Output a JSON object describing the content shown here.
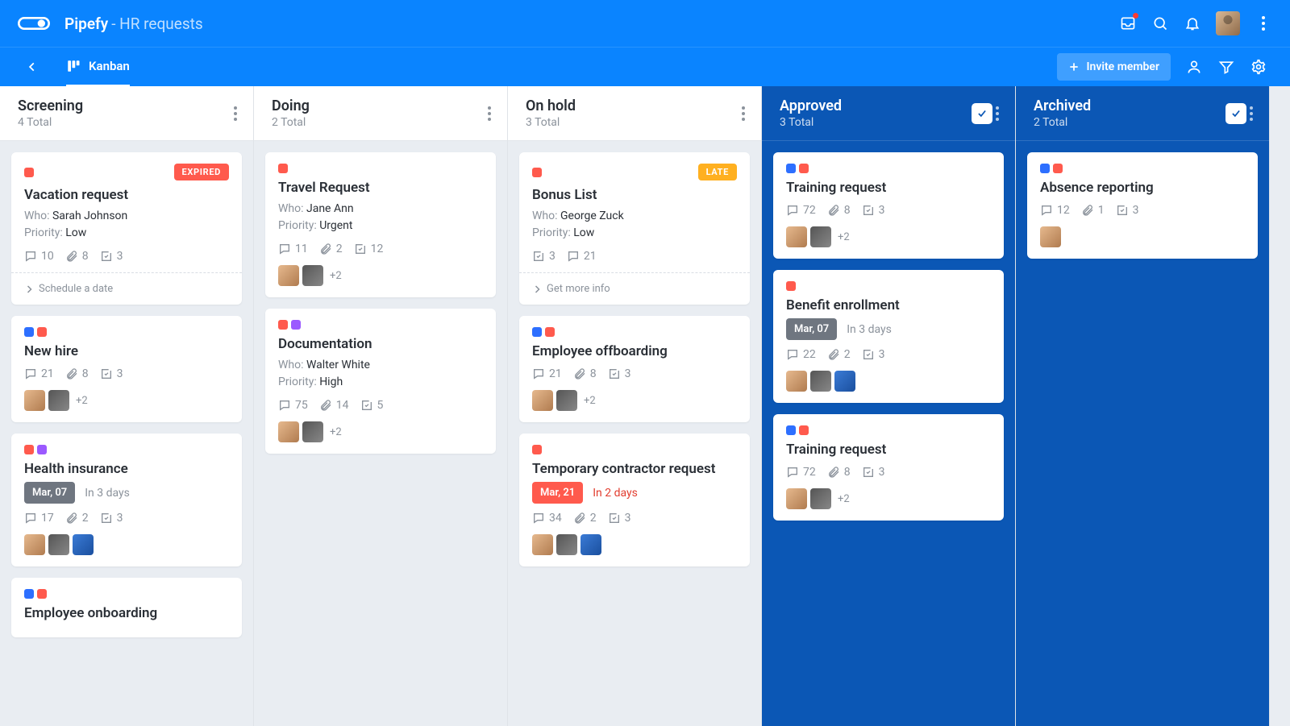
{
  "header": {
    "app": "Pipefy",
    "pipe": "HR requests",
    "invite_label": "Invite member",
    "kanban_label": "Kanban"
  },
  "columns": [
    {
      "title": "Screening",
      "count": "4 Total",
      "final": false,
      "cards": [
        {
          "labels": [
            "red"
          ],
          "badge": {
            "text": "EXPIRED",
            "type": "expired"
          },
          "title": "Vacation request",
          "who": "Sarah Johnson",
          "priority": "Low",
          "stats": {
            "comments": 10,
            "attach": 8,
            "tasks": 3
          },
          "action": "Schedule a date"
        },
        {
          "labels": [
            "blue",
            "red"
          ],
          "title": "New hire",
          "stats": {
            "comments": 21,
            "attach": 8,
            "tasks": 3
          },
          "assignees": {
            "list": [
              "a1",
              "a2"
            ],
            "more": "+2"
          }
        },
        {
          "labels": [
            "red",
            "purple"
          ],
          "title": "Health insurance",
          "due": {
            "chip": "Mar, 07",
            "chip_style": "gray",
            "rel": "In 3 days",
            "rel_style": "gray"
          },
          "stats": {
            "comments": 17,
            "attach": 2,
            "tasks": 3
          },
          "assignees": {
            "list": [
              "a1",
              "a2",
              "a3"
            ]
          }
        },
        {
          "labels": [
            "blue",
            "red"
          ],
          "title": "Employee onboarding"
        }
      ]
    },
    {
      "title": "Doing",
      "count": "2 Total",
      "final": false,
      "cards": [
        {
          "labels": [
            "red"
          ],
          "title": "Travel Request",
          "who": "Jane Ann",
          "priority": "Urgent",
          "stats": {
            "comments": 11,
            "attach": 2,
            "tasks": 12
          },
          "assignees": {
            "list": [
              "a1",
              "a2"
            ],
            "more": "+2"
          }
        },
        {
          "labels": [
            "red",
            "purple"
          ],
          "title": "Documentation",
          "who": "Walter White",
          "priority": "High",
          "stats": {
            "comments": 75,
            "attach": 14,
            "tasks": 5
          },
          "assignees": {
            "list": [
              "a1",
              "a2"
            ],
            "more": "+2"
          }
        }
      ]
    },
    {
      "title": "On hold",
      "count": "3 Total",
      "final": false,
      "cards": [
        {
          "labels": [
            "red"
          ],
          "badge": {
            "text": "LATE",
            "type": "late"
          },
          "title": "Bonus List",
          "who": "George Zuck",
          "priority": "Low",
          "stats": {
            "tasks": 3,
            "comments": 21
          },
          "action": "Get more info"
        },
        {
          "labels": [
            "blue",
            "red"
          ],
          "title": "Employee offboarding",
          "stats": {
            "comments": 21,
            "attach": 8,
            "tasks": 3
          },
          "assignees": {
            "list": [
              "a1",
              "a2"
            ],
            "more": "+2"
          }
        },
        {
          "labels": [
            "red"
          ],
          "title": "Temporary contractor request",
          "due": {
            "chip": "Mar, 21",
            "chip_style": "red",
            "rel": "In 2 days",
            "rel_style": "red"
          },
          "stats": {
            "comments": 34,
            "attach": 2,
            "tasks": 3
          },
          "assignees": {
            "list": [
              "a1",
              "a2",
              "a3"
            ]
          }
        }
      ]
    },
    {
      "title": "Approved",
      "count": "3 Total",
      "final": true,
      "cards": [
        {
          "labels": [
            "blue",
            "red"
          ],
          "title": "Training request",
          "stats": {
            "comments": 72,
            "attach": 8,
            "tasks": 3
          },
          "assignees": {
            "list": [
              "a1",
              "a2"
            ],
            "more": "+2"
          }
        },
        {
          "labels": [
            "red"
          ],
          "title": "Benefit enrollment",
          "due": {
            "chip": "Mar, 07",
            "chip_style": "gray",
            "rel": "In 3 days",
            "rel_style": "gray"
          },
          "stats": {
            "comments": 22,
            "attach": 2,
            "tasks": 3
          },
          "assignees": {
            "list": [
              "a1",
              "a2",
              "a3"
            ]
          }
        },
        {
          "labels": [
            "blue",
            "red"
          ],
          "title": "Training request",
          "stats": {
            "comments": 72,
            "attach": 8,
            "tasks": 3
          },
          "assignees": {
            "list": [
              "a1",
              "a2"
            ],
            "more": "+2"
          }
        }
      ]
    },
    {
      "title": "Archived",
      "count": "2 Total",
      "final": true,
      "cards": [
        {
          "labels": [
            "blue",
            "red"
          ],
          "title": "Absence reporting",
          "stats": {
            "comments": 12,
            "attach": 1,
            "tasks": 3
          },
          "assignees": {
            "list": [
              "a1"
            ]
          }
        }
      ]
    }
  ],
  "label_colors": {
    "red": "#ff5a4d",
    "purple": "#9b59ff",
    "blue": "#2d6fff"
  },
  "meta_labels": {
    "who": "Who:",
    "priority": "Priority:"
  }
}
